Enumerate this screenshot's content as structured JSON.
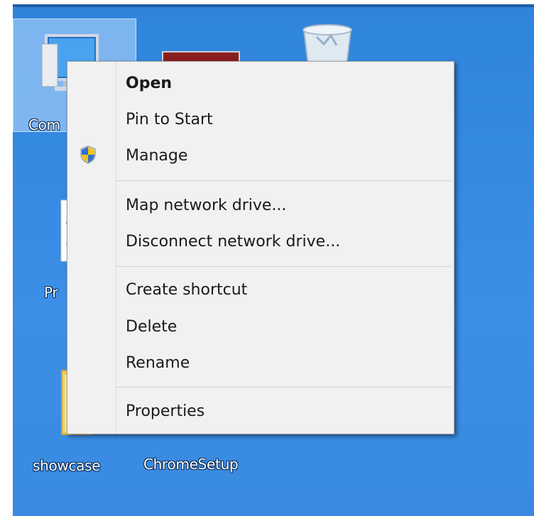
{
  "desktop": {
    "icons": [
      {
        "label": "Com"
      },
      {
        "label": "Pr"
      },
      {
        "label": "showcase"
      },
      {
        "label": "ChromeSetup"
      }
    ]
  },
  "context_menu": {
    "items": [
      {
        "label": "Open",
        "bold": true
      },
      {
        "label": "Pin to Start"
      },
      {
        "label": "Manage",
        "icon": "uac-shield-icon"
      },
      {
        "label": "Map network drive..."
      },
      {
        "label": "Disconnect network drive..."
      },
      {
        "label": "Create shortcut"
      },
      {
        "label": "Delete"
      },
      {
        "label": "Rename"
      },
      {
        "label": "Properties"
      }
    ]
  },
  "colors": {
    "desktop_blue": "#3a8ae1",
    "menu_background": "#f1f1f1"
  }
}
